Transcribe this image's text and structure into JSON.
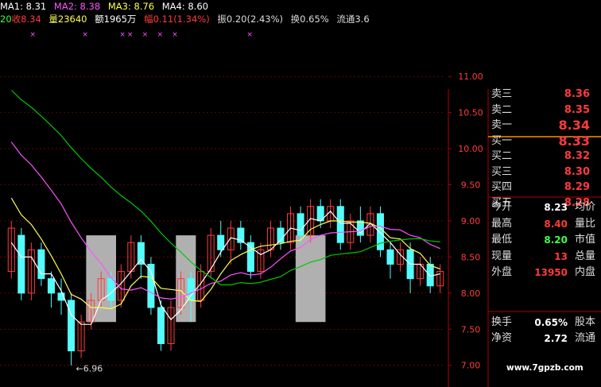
{
  "indicator_bar": {
    "ma1": "MA1: 8.31",
    "ma2": "MA2: 8.38",
    "ma3": "MA3: 8.76",
    "ma4": "MA4: 8.60"
  },
  "stats_bar": {
    "date_prefix": "20",
    "close": "收8.34",
    "volume": "量23640",
    "amount": "额1965万",
    "change": "幅0.11(1.34%)",
    "amplitude": "振0.20(2.43%)",
    "turnover": "换0.65%",
    "float": "流通3.6"
  },
  "colors": {
    "up": "#ff3b3b",
    "down": "#54fcfc",
    "ma1": "#ffffff",
    "ma2": "#ffff54",
    "ma3": "#ff54ff",
    "ma4": "#00c800",
    "grid": "#b00000",
    "axis_text": "#ff3b3b",
    "green_text": "#40ff40"
  },
  "price_axis": {
    "ticks": [
      "11.00",
      "10.50",
      "10.00",
      "9.50",
      "9.00",
      "8.50",
      "8.00",
      "7.50",
      "7.00"
    ],
    "tick_values": [
      11.0,
      10.5,
      10.0,
      9.5,
      9.0,
      8.5,
      8.0,
      7.5,
      7.0
    ]
  },
  "low_marker": "6.96",
  "order_book": [
    {
      "label": "卖三",
      "value": "8.36",
      "big": false
    },
    {
      "label": "卖二",
      "value": "8.35",
      "big": false
    },
    {
      "label": "卖一",
      "value": "8.34",
      "big": true
    },
    {
      "label": "买一",
      "value": "8.33",
      "big": true
    },
    {
      "label": "买二",
      "value": "8.32",
      "big": false
    },
    {
      "label": "买三",
      "value": "8.30",
      "big": false
    },
    {
      "label": "买四",
      "value": "8.29",
      "big": false
    },
    {
      "label": "买五",
      "value": "8.28",
      "big": false
    }
  ],
  "summary": [
    {
      "label": "今开",
      "value": "8.23",
      "value_color": "#ffffff",
      "label2": "均价"
    },
    {
      "label": "最高",
      "value": "8.40",
      "value_color": "#ff3b3b",
      "label2": "量比"
    },
    {
      "label": "最低",
      "value": "8.20",
      "value_color": "#40ff40",
      "label2": "市值"
    },
    {
      "label": "现量",
      "value": "13",
      "value_color": "#ff3b3b",
      "label2": "总量"
    },
    {
      "label": "外盘",
      "value": "13950",
      "value_color": "#ff3b3b",
      "label2": "内盘"
    },
    {
      "label": "换手",
      "value": "0.65%",
      "value_color": "#ffffff",
      "label2": "股本"
    },
    {
      "label": "净资",
      "value": "2.72",
      "value_color": "#ffffff",
      "label2": "流通"
    }
  ],
  "watermark": "www.7gpzb.com",
  "chart_data": {
    "type": "candlestick",
    "ylim": [
      6.7,
      11.2
    ],
    "highlight_ranges": [
      [
        8,
        10
      ],
      [
        17,
        18
      ],
      [
        29,
        31
      ]
    ],
    "candles": [
      [
        8.3,
        8.9,
        8.2,
        9.0
      ],
      [
        8.8,
        8.0,
        7.9,
        8.9
      ],
      [
        8.0,
        8.6,
        7.9,
        8.7
      ],
      [
        8.6,
        8.2,
        8.1,
        8.7
      ],
      [
        8.2,
        8.0,
        7.8,
        8.3
      ],
      [
        8.0,
        7.9,
        7.7,
        8.2
      ],
      [
        7.9,
        7.2,
        7.0,
        8.0
      ],
      [
        7.2,
        7.6,
        7.1,
        7.7
      ],
      [
        7.6,
        7.9,
        7.5,
        8.0
      ],
      [
        7.9,
        8.2,
        7.8,
        8.3
      ],
      [
        8.2,
        7.9,
        7.8,
        8.3
      ],
      [
        7.9,
        8.3,
        7.8,
        8.4
      ],
      [
        8.3,
        8.7,
        8.2,
        8.8
      ],
      [
        8.7,
        8.4,
        8.2,
        8.8
      ],
      [
        8.4,
        7.8,
        7.7,
        8.5
      ],
      [
        7.8,
        7.3,
        7.2,
        7.9
      ],
      [
        7.3,
        7.8,
        7.2,
        7.9
      ],
      [
        7.8,
        8.2,
        7.7,
        8.3
      ],
      [
        8.2,
        7.9,
        7.6,
        8.3
      ],
      [
        7.9,
        8.3,
        7.8,
        8.4
      ],
      [
        8.3,
        8.8,
        8.2,
        8.9
      ],
      [
        8.8,
        8.6,
        8.5,
        9.0
      ],
      [
        8.6,
        8.9,
        8.4,
        9.0
      ],
      [
        8.9,
        8.7,
        8.6,
        9.0
      ],
      [
        8.7,
        8.3,
        8.2,
        8.8
      ],
      [
        8.3,
        8.6,
        8.2,
        8.7
      ],
      [
        8.6,
        8.9,
        8.5,
        9.0
      ],
      [
        8.9,
        8.7,
        8.6,
        9.0
      ],
      [
        8.7,
        9.1,
        8.6,
        9.2
      ],
      [
        9.1,
        8.8,
        8.7,
        9.2
      ],
      [
        8.8,
        9.2,
        8.7,
        9.3
      ],
      [
        9.2,
        9.0,
        8.9,
        9.3
      ],
      [
        9.0,
        9.2,
        8.9,
        9.3
      ],
      [
        9.2,
        8.7,
        8.6,
        9.3
      ],
      [
        8.7,
        9.0,
        8.6,
        9.1
      ],
      [
        9.0,
        8.8,
        8.7,
        9.2
      ],
      [
        8.8,
        9.1,
        8.7,
        9.2
      ],
      [
        9.1,
        8.6,
        8.5,
        9.2
      ],
      [
        8.6,
        8.4,
        8.2,
        8.7
      ],
      [
        8.4,
        8.6,
        8.3,
        8.7
      ],
      [
        8.6,
        8.2,
        8.0,
        8.7
      ],
      [
        8.2,
        8.4,
        8.1,
        8.5
      ],
      [
        8.4,
        8.1,
        8.0,
        8.5
      ],
      [
        8.1,
        8.3,
        8.0,
        8.4
      ]
    ]
  }
}
